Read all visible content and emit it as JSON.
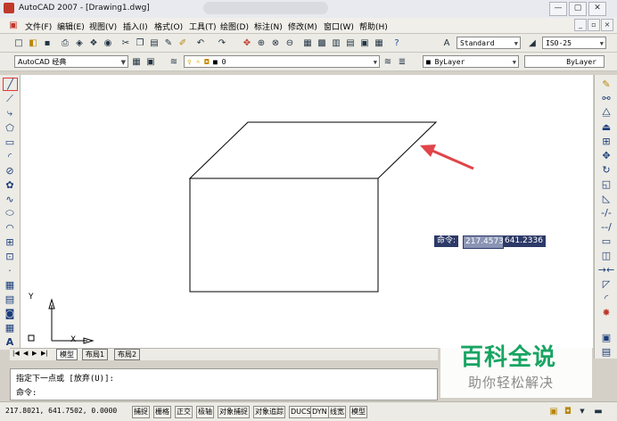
{
  "window": {
    "title": "AutoCAD 2007 - [Drawing1.dwg]",
    "controls": [
      "—",
      "▢",
      "✕"
    ],
    "doc_controls": [
      "_",
      "▫",
      "×"
    ]
  },
  "menubar": {
    "items": [
      "文件(F)",
      "编辑(E)",
      "视图(V)",
      "插入(I)",
      "格式(O)",
      "工具(T)",
      "绘图(D)",
      "标注(N)",
      "修改(M)",
      "窗口(W)",
      "帮助(H)"
    ]
  },
  "toolbar": {
    "text_style": "Standard",
    "dim_style": "ISO-25",
    "workspace": "AutoCAD 经典",
    "layer": "0",
    "color": "ByLayer",
    "linetype": "ByLayer",
    "lineweight": "ByLayer"
  },
  "canvas": {
    "ucs_y": "Y",
    "ucs_x": "X",
    "dynamic_input": {
      "label": "命令:",
      "value1": "217.4573",
      "value2": "641.2336"
    }
  },
  "layout_tabs": [
    "模型",
    "布局1",
    "布局2"
  ],
  "command": {
    "line1": "指定下一点或 [放弃(U)]:",
    "line2": "命令:"
  },
  "status": {
    "coords": "217.8021, 641.7502, 0.0000",
    "buttons": [
      "捕捉",
      "栅格",
      "正交",
      "极轴",
      "对象捕捉",
      "对象追踪",
      "DUCS",
      "DYN",
      "线宽",
      "模型"
    ]
  },
  "watermark": {
    "title": "百科全说",
    "subtitle": "助你轻松解决"
  },
  "colors": {
    "arrow": "#e0454a",
    "watermark": "#19a463",
    "dynamic_input_bg": "#2d3a68"
  }
}
